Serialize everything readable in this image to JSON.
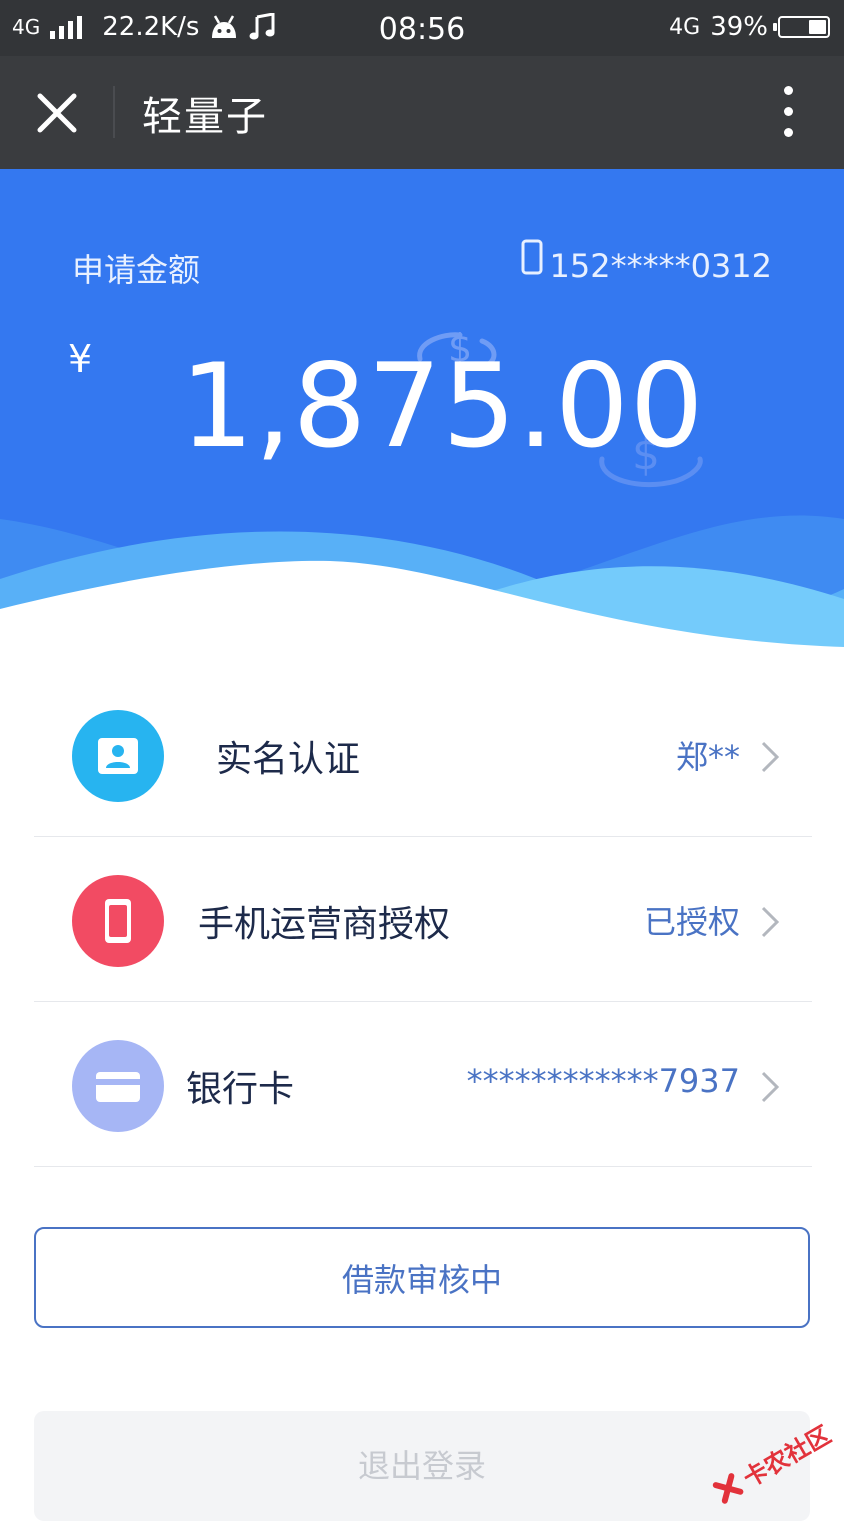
{
  "status_bar": {
    "network": "4G",
    "speed": "22.2K/s",
    "time": "08:56",
    "right_network": "4G",
    "battery": "39%",
    "battery_level": 0.39
  },
  "titlebar": {
    "title": "轻量子"
  },
  "hero": {
    "label": "申请金额",
    "phone": "152*****0312",
    "currency": "¥",
    "amount": "1,875.00"
  },
  "list": [
    {
      "label": "实名认证",
      "value": "郑**",
      "icon": "id-card-icon",
      "color": "#27b4f0"
    },
    {
      "label": "手机运营商授权",
      "value": "已授权",
      "icon": "mobile-phone-icon",
      "color": "#f24b63"
    },
    {
      "label": "银行卡",
      "value": "************7937",
      "icon": "bank-card-icon",
      "color": "#a6b6f5"
    }
  ],
  "buttons": {
    "status": "借款审核中",
    "logout": "退出登录"
  },
  "watermark": {
    "text": "卡农社区"
  },
  "colors": {
    "hero_blue": "#3478f0",
    "accent": "#4a73c4",
    "titlebar": "#3a3c3f"
  }
}
